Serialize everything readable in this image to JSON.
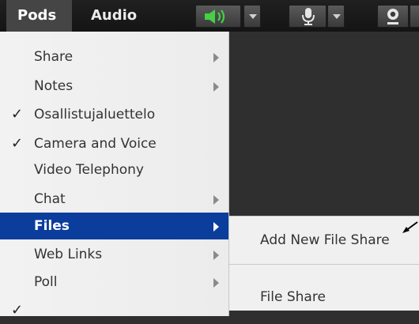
{
  "menubar": {
    "pods_label": "Pods",
    "audio_label": "Audio",
    "speaker_icon": "speaker-icon",
    "mic_icon": "microphone-icon",
    "camera_icon": "webcam-icon",
    "accent_green": "#3cc23c"
  },
  "pods_menu": {
    "items": [
      {
        "label": "Share",
        "checked": false,
        "submenu": true
      },
      {
        "label": "Notes",
        "checked": false,
        "submenu": true
      },
      {
        "label": "Osallistujaluettelo",
        "checked": true,
        "submenu": false
      },
      {
        "label": "Camera and Voice",
        "checked": true,
        "submenu": false
      },
      {
        "label": "Video Telephony",
        "checked": false,
        "submenu": false
      },
      {
        "label": "Chat",
        "checked": false,
        "submenu": true
      },
      {
        "label": "Files",
        "checked": false,
        "submenu": true,
        "active": true
      },
      {
        "label": "Web Links",
        "checked": false,
        "submenu": true
      },
      {
        "label": "Poll",
        "checked": false,
        "submenu": true
      }
    ],
    "check_glyph": "✓",
    "highlight_color": "#0a3d9c"
  },
  "files_submenu": {
    "add_new": "Add New File Share",
    "file_share": "File Share"
  }
}
